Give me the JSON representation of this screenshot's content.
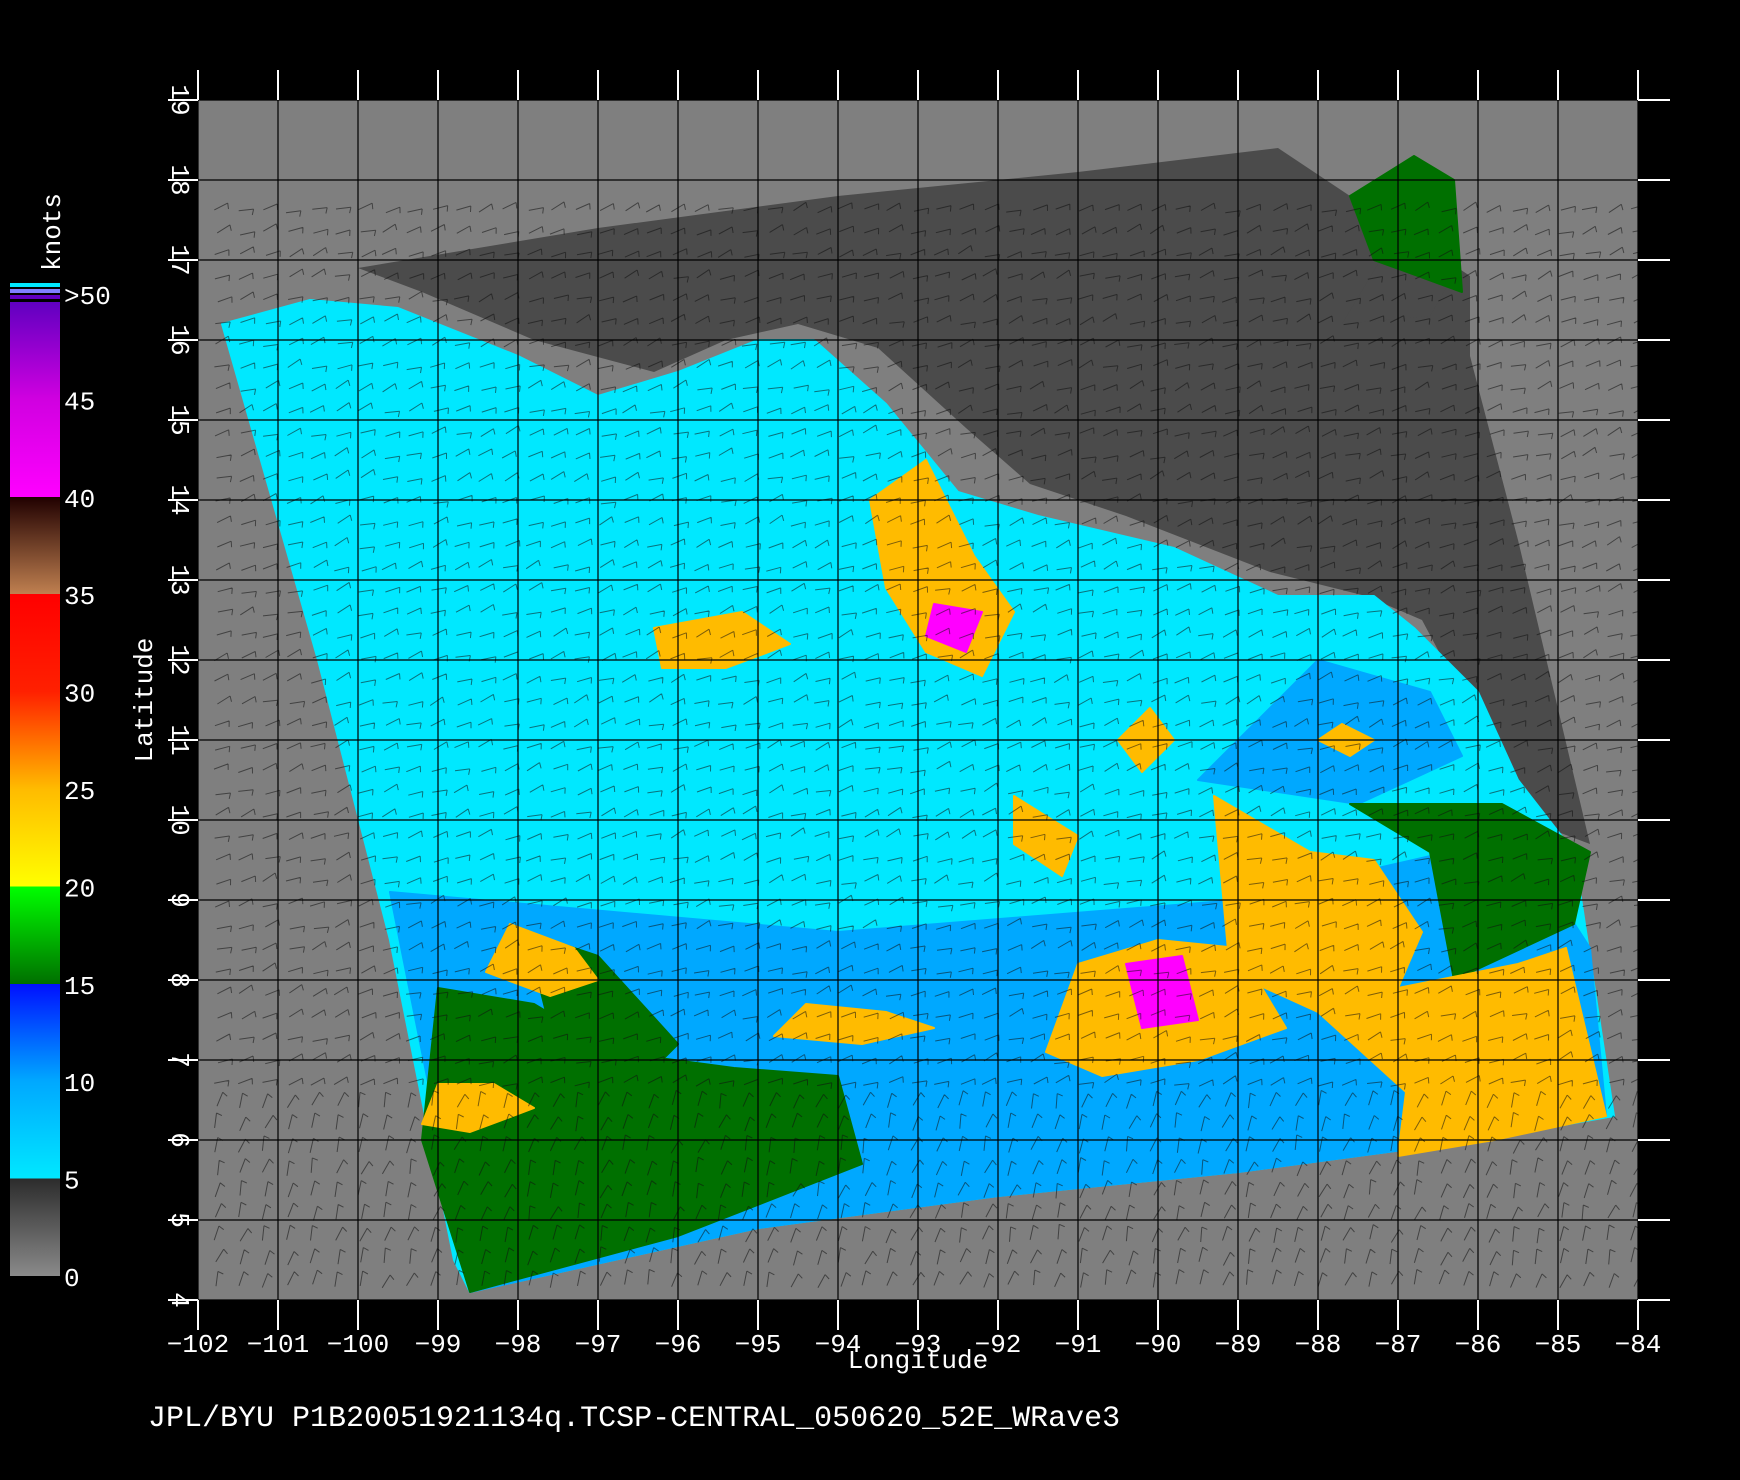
{
  "caption": "JPL/BYU  P1B20051921134q.TCSP-CENTRAL_050620_52E_WRave3",
  "map": {
    "xlabel": "Longitude",
    "ylabel": "Latitude",
    "lon_range": [
      -102,
      -84
    ],
    "lat_range": [
      4,
      19
    ],
    "lon_ticks": [
      "-102",
      "-101",
      "-100",
      "-99",
      "-98",
      "-97",
      "-96",
      "-95",
      "-94",
      "-93",
      "-92",
      "-91",
      "-90",
      "-89",
      "-88",
      "-87",
      "-86",
      "-85",
      "-84"
    ],
    "lat_ticks": [
      "4",
      "5",
      "6",
      "7",
      "8",
      "9",
      "10",
      "11",
      "12",
      "13",
      "14",
      "15",
      "16",
      "17",
      "18",
      "19"
    ],
    "grid": true,
    "colors": {
      "background": "#000000",
      "no_data": "#7f7f7f",
      "land": "#4b4b4b",
      "grid": "#000000",
      "frame": "#ffffff"
    }
  },
  "colorbar": {
    "title": "knots",
    "labels": [
      ">50",
      "45",
      "40",
      "35",
      "30",
      "25",
      "20",
      "15",
      "10",
      "5",
      "0"
    ],
    "stops": [
      {
        "value": 0,
        "color": "#8a8a8a"
      },
      {
        "value": 5,
        "color": "#2c2c2c"
      },
      {
        "value": 5,
        "color": "#00e8ff"
      },
      {
        "value": 10,
        "color": "#00a8ff"
      },
      {
        "value": 15,
        "color": "#0010ff"
      },
      {
        "value": 15,
        "color": "#007000"
      },
      {
        "value": 20,
        "color": "#00ff00"
      },
      {
        "value": 20,
        "color": "#ffff00"
      },
      {
        "value": 25,
        "color": "#ffbb00"
      },
      {
        "value": 30,
        "color": "#ff2000"
      },
      {
        "value": 35,
        "color": "#ff0000"
      },
      {
        "value": 35,
        "color": "#c08050"
      },
      {
        "value": 40,
        "color": "#200000"
      },
      {
        "value": 40,
        "color": "#ff00ff"
      },
      {
        "value": 45,
        "color": "#d000e0"
      },
      {
        "value": 50,
        "color": "#6000c0"
      }
    ]
  },
  "wind_regions": [
    {
      "knots": 8,
      "pts": [
        [
          -101.7,
          16.2
        ],
        [
          -100.6,
          16.5
        ],
        [
          -99.5,
          16.4
        ],
        [
          -98.0,
          15.8
        ],
        [
          -97.0,
          15.3
        ],
        [
          -96.0,
          15.6
        ],
        [
          -95.0,
          16.0
        ],
        [
          -94.3,
          16.0
        ],
        [
          -93.4,
          15.2
        ],
        [
          -92.5,
          14.1
        ],
        [
          -91.5,
          13.8
        ],
        [
          -89.8,
          13.4
        ],
        [
          -88.5,
          12.8
        ],
        [
          -87.3,
          12.8
        ],
        [
          -86.8,
          12.4
        ],
        [
          -86.0,
          11.6
        ],
        [
          -85.5,
          10.5
        ],
        [
          -84.8,
          9.6
        ],
        [
          -84.3,
          6.3
        ],
        [
          -86.0,
          6.0
        ],
        [
          -89.0,
          5.6
        ],
        [
          -92.0,
          5.3
        ],
        [
          -95.0,
          4.9
        ],
        [
          -98.6,
          4.1
        ],
        [
          -98.8,
          4.5
        ],
        [
          -99.6,
          8.5
        ],
        [
          -100.5,
          12.0
        ]
      ]
    },
    {
      "knots": 13,
      "pts": [
        [
          -99.6,
          9.1
        ],
        [
          -94.0,
          8.6
        ],
        [
          -89.0,
          9.0
        ],
        [
          -85.5,
          9.8
        ],
        [
          -84.6,
          8.4
        ],
        [
          -84.4,
          6.3
        ],
        [
          -86.0,
          6.0
        ],
        [
          -89.0,
          5.6
        ],
        [
          -92.0,
          5.3
        ],
        [
          -95.0,
          4.9
        ],
        [
          -98.6,
          4.1
        ]
      ]
    },
    {
      "knots": 13,
      "pts": [
        [
          -88.0,
          12.0
        ],
        [
          -86.6,
          11.6
        ],
        [
          -86.2,
          10.8
        ],
        [
          -87.5,
          10.2
        ],
        [
          -89.5,
          10.5
        ]
      ]
    },
    {
      "knots": 18,
      "pts": [
        [
          -99.0,
          7.9
        ],
        [
          -97.8,
          7.7
        ],
        [
          -96.8,
          7.1
        ],
        [
          -95.3,
          6.9
        ],
        [
          -94.0,
          6.8
        ],
        [
          -93.7,
          5.7
        ],
        [
          -96.0,
          4.8
        ],
        [
          -98.6,
          4.1
        ],
        [
          -99.2,
          6.0
        ]
      ]
    },
    {
      "knots": 18,
      "pts": [
        [
          -97.9,
          8.6
        ],
        [
          -97.0,
          8.3
        ],
        [
          -96.0,
          7.2
        ],
        [
          -96.5,
          6.7
        ],
        [
          -97.6,
          7.4
        ]
      ]
    },
    {
      "knots": 18,
      "pts": [
        [
          -87.6,
          10.2
        ],
        [
          -86.6,
          9.6
        ],
        [
          -86.3,
          8.0
        ],
        [
          -84.8,
          8.7
        ],
        [
          -84.6,
          9.6
        ],
        [
          -85.7,
          10.2
        ]
      ]
    },
    {
      "knots": 18,
      "pts": [
        [
          -86.8,
          18.3
        ],
        [
          -86.3,
          18.0
        ],
        [
          -86.2,
          16.6
        ],
        [
          -87.3,
          17.0
        ],
        [
          -87.6,
          17.8
        ]
      ]
    },
    {
      "knots": 28,
      "pts": [
        [
          -89.3,
          10.3
        ],
        [
          -88.1,
          9.6
        ],
        [
          -87.3,
          9.5
        ],
        [
          -86.7,
          8.6
        ],
        [
          -87.0,
          7.9
        ],
        [
          -85.5,
          8.2
        ],
        [
          -84.9,
          8.4
        ],
        [
          -84.4,
          6.3
        ],
        [
          -85.8,
          6.0
        ],
        [
          -87.0,
          5.8
        ],
        [
          -86.9,
          6.6
        ],
        [
          -88.0,
          7.6
        ],
        [
          -89.1,
          8.1
        ]
      ]
    },
    {
      "knots": 28,
      "pts": [
        [
          -91.0,
          8.2
        ],
        [
          -90.0,
          8.5
        ],
        [
          -89.0,
          8.4
        ],
        [
          -88.4,
          7.4
        ],
        [
          -89.5,
          7.0
        ],
        [
          -90.7,
          6.8
        ],
        [
          -91.4,
          7.1
        ]
      ]
    },
    {
      "knots": 28,
      "pts": [
        [
          -92.9,
          14.5
        ],
        [
          -92.3,
          13.3
        ],
        [
          -91.8,
          12.6
        ],
        [
          -92.2,
          11.8
        ],
        [
          -92.9,
          12.1
        ],
        [
          -93.4,
          12.9
        ],
        [
          -93.6,
          14.0
        ]
      ]
    },
    {
      "knots": 28,
      "pts": [
        [
          -98.1,
          8.7
        ],
        [
          -97.3,
          8.4
        ],
        [
          -97.0,
          8.0
        ],
        [
          -97.6,
          7.8
        ],
        [
          -98.4,
          8.1
        ]
      ]
    },
    {
      "knots": 28,
      "pts": [
        [
          -94.4,
          7.7
        ],
        [
          -93.4,
          7.6
        ],
        [
          -92.8,
          7.4
        ],
        [
          -93.7,
          7.2
        ],
        [
          -94.8,
          7.3
        ]
      ]
    },
    {
      "knots": 28,
      "pts": [
        [
          -96.3,
          12.4
        ],
        [
          -95.2,
          12.6
        ],
        [
          -94.6,
          12.2
        ],
        [
          -95.4,
          11.9
        ],
        [
          -96.2,
          11.9
        ]
      ]
    },
    {
      "knots": 28,
      "pts": [
        [
          -99.0,
          6.7
        ],
        [
          -98.3,
          6.7
        ],
        [
          -97.8,
          6.4
        ],
        [
          -98.6,
          6.1
        ],
        [
          -99.2,
          6.2
        ]
      ]
    },
    {
      "knots": 28,
      "pts": [
        [
          -91.8,
          10.3
        ],
        [
          -91.0,
          9.8
        ],
        [
          -91.2,
          9.3
        ],
        [
          -91.8,
          9.7
        ]
      ]
    },
    {
      "knots": 28,
      "pts": [
        [
          -90.1,
          11.4
        ],
        [
          -89.8,
          11.0
        ],
        [
          -90.2,
          10.6
        ],
        [
          -90.5,
          11.0
        ]
      ]
    },
    {
      "knots": 28,
      "pts": [
        [
          -87.7,
          11.2
        ],
        [
          -87.3,
          11.0
        ],
        [
          -87.6,
          10.8
        ],
        [
          -88.0,
          11.0
        ]
      ]
    },
    {
      "knots": 43,
      "pts": [
        [
          -90.4,
          8.2
        ],
        [
          -89.7,
          8.3
        ],
        [
          -89.5,
          7.5
        ],
        [
          -90.2,
          7.4
        ]
      ]
    },
    {
      "knots": 43,
      "pts": [
        [
          -92.8,
          12.7
        ],
        [
          -92.2,
          12.6
        ],
        [
          -92.4,
          12.1
        ],
        [
          -92.9,
          12.3
        ]
      ]
    }
  ]
}
